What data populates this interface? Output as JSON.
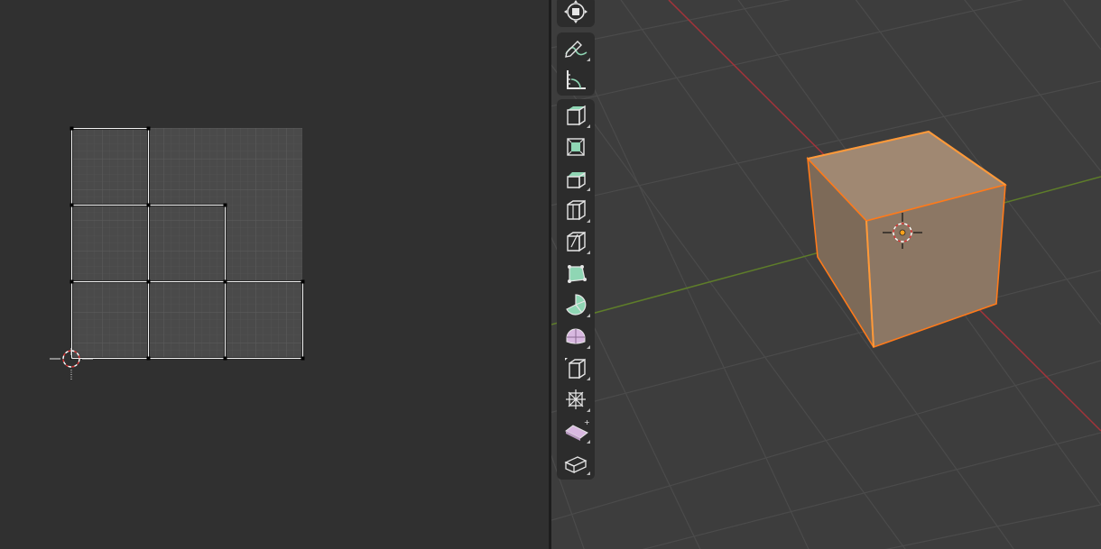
{
  "app": "Blender",
  "colors": {
    "uv_background": "#303030",
    "uv_image": "#4a4a4a",
    "uv_edges": "#ffffff",
    "viewport_background": "#3d3d3d",
    "viewport_grid": "#4b4b4b",
    "axis_x": "#a2343a",
    "axis_y": "#5e7d2a",
    "selection_outline": "#ff7a1a",
    "selected_face_fill": "#a08872",
    "toolbar_background": "#2c2c2c",
    "tool_icon_accent": "#8fd6b4"
  },
  "uv_editor": {
    "icons": [
      "2d-cursor-icon"
    ]
  },
  "viewport": {
    "object": "cube",
    "icons": [
      "3d-cursor-icon",
      "origin-dot-icon"
    ]
  },
  "toolbar": {
    "tools": [
      {
        "id": "transform",
        "icon": "transform-gizmo-icon"
      },
      {
        "id": "annotate",
        "icon": "annotate-pencil-icon"
      },
      {
        "id": "measure",
        "icon": "measure-ruler-icon"
      },
      {
        "id": "extrude-region",
        "icon": "extrude-region-icon"
      },
      {
        "id": "inset-faces",
        "icon": "inset-faces-icon"
      },
      {
        "id": "bevel",
        "icon": "bevel-icon"
      },
      {
        "id": "loop-cut",
        "icon": "loop-cut-icon"
      },
      {
        "id": "knife",
        "icon": "knife-icon"
      },
      {
        "id": "poly-build",
        "icon": "poly-build-icon"
      },
      {
        "id": "spin",
        "icon": "spin-icon"
      },
      {
        "id": "smooth",
        "icon": "smooth-vertices-icon"
      },
      {
        "id": "edge-slide",
        "icon": "edge-slide-icon"
      },
      {
        "id": "shrink-fatten",
        "icon": "shrink-fatten-icon"
      },
      {
        "id": "shear",
        "icon": "shear-icon"
      },
      {
        "id": "rip-region",
        "icon": "rip-region-icon"
      }
    ]
  }
}
